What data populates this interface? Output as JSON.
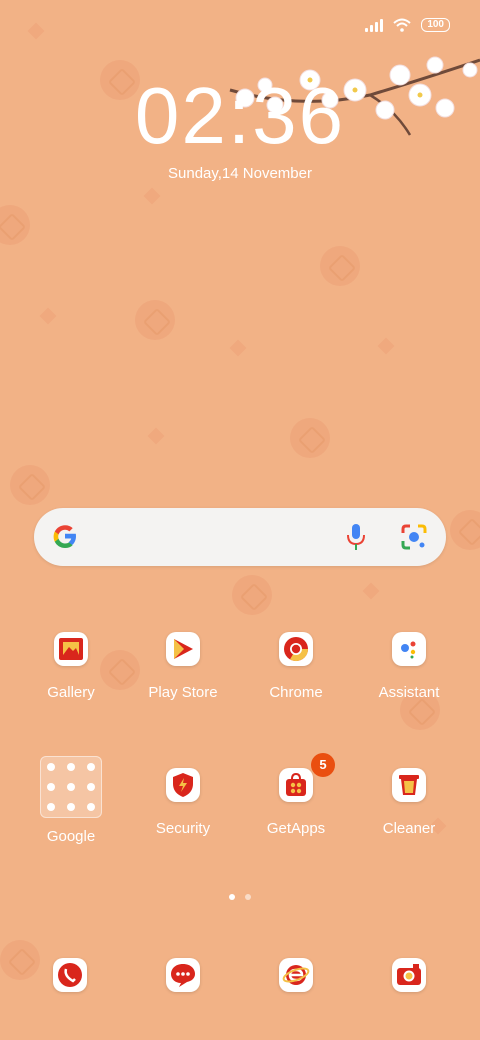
{
  "status_bar": {
    "battery": "100",
    "signal_icon": "signal-icon",
    "wifi_icon": "wifi-icon"
  },
  "clock": {
    "time": "02:36",
    "date": "Sunday,14 November"
  },
  "search_bar": {
    "logo": "google-g-icon",
    "mic": "mic-icon",
    "lens": "lens-icon"
  },
  "apps_row1": [
    {
      "label": "Gallery",
      "icon": "gallery-icon"
    },
    {
      "label": "Play Store",
      "icon": "play-store-icon"
    },
    {
      "label": "Chrome",
      "icon": "chrome-icon"
    },
    {
      "label": "Assistant",
      "icon": "assistant-icon"
    }
  ],
  "apps_row2": [
    {
      "label": "Google",
      "icon": "google-folder-icon"
    },
    {
      "label": "Security",
      "icon": "security-icon"
    },
    {
      "label": "GetApps",
      "icon": "getapps-icon",
      "badge": "5"
    },
    {
      "label": "Cleaner",
      "icon": "cleaner-icon"
    }
  ],
  "page_indicator": {
    "pages": 2,
    "current": 1
  },
  "dock": [
    {
      "icon": "phone-icon"
    },
    {
      "icon": "messages-icon"
    },
    {
      "icon": "browser-icon"
    },
    {
      "icon": "camera-icon"
    }
  ],
  "colors": {
    "background": "#f2b286",
    "accent_red": "#d9261c",
    "badge": "#ea4f10"
  }
}
